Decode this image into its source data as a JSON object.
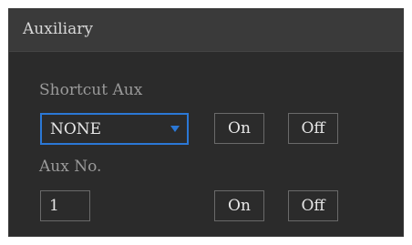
{
  "window": {
    "title": "Auxiliary"
  },
  "shortcut_aux": {
    "label": "Shortcut Aux",
    "selected": "NONE",
    "on_label": "On",
    "off_label": "Off"
  },
  "aux_no": {
    "label": "Aux No.",
    "value": "1",
    "on_label": "On",
    "off_label": "Off"
  },
  "colors": {
    "accent": "#2b78d6",
    "panel_bg": "#2b2b2b",
    "titlebar_bg": "#3a3a3a"
  },
  "icons": {
    "dropdown": "chevron-down-icon"
  }
}
